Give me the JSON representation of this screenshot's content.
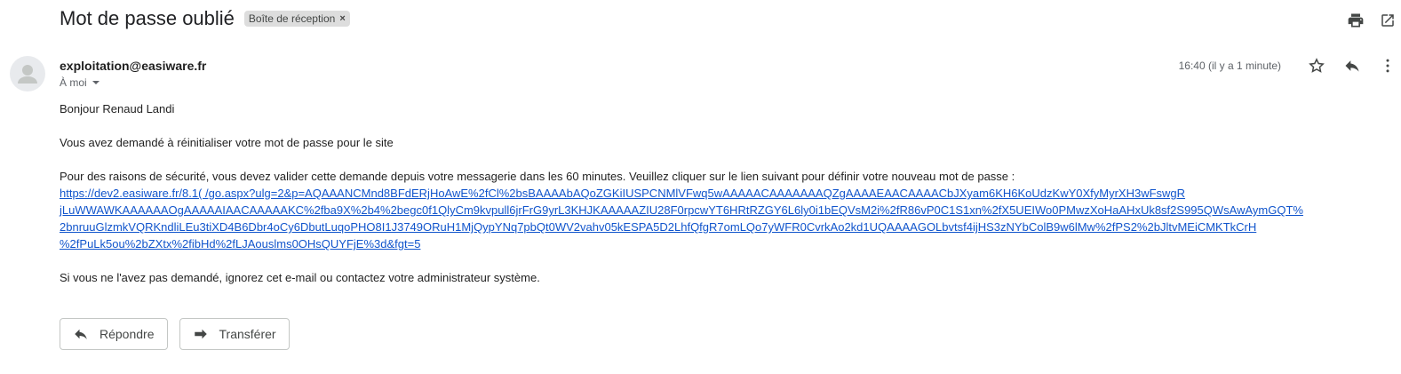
{
  "header": {
    "subject": "Mot de passe oublié",
    "label": "Boîte de réception",
    "label_remove": "×",
    "icons": [
      "print-icon",
      "open-in-new-window-icon"
    ]
  },
  "message": {
    "sender": "exploitation@easiware.fr",
    "recipient": "À moi",
    "time": "16:40 (il y a 1 minute)",
    "icons": [
      "star-icon",
      "reply-icon",
      "more-vertical-icon"
    ],
    "body": {
      "greeting": "Bonjour Renaud Landi",
      "line1": "Vous avez demandé à réinitialiser votre mot de passe pour le site",
      "line2": "Pour des raisons de sécurité, vous devez valider cette demande depuis votre messagerie dans les 60 minutes. Veuillez cliquer sur le lien suivant pour définir votre nouveau mot de passe :",
      "link_lines": [
        "https://dev2.easiware.fr/8.1(                              /go.aspx?ulg=2&p=AQAAANCMnd8BFdERjHoAwE%2fCl%2bsBAAAAbAQoZGKiIUSPCNMlVFwq5wAAAAACAAAAAAAQZgAAAAEAACAAAACbJXyam6KH6KoUdzKwY0XfyMyrXH3wFswgR",
        "jLuWWAWKAAAAAAOgAAAAAIAACAAAAAKC%2fba9X%2b4%2begc0f1QlyCm9kvpull6jrFrG9yrL3KHJKAAAAAZIU28F0rpcwYT6HRtRZGY6L6ly0i1bEQVsM2i%2fR86vP0C1S1xn%2fX5UEIWo0PMwzXoHaAHxUk8sf2S995QWsAwAymGQT%",
        "2bnruuGlzmkVQRKndliLEu3tiXD4B6Dbr4oCy6DbutLuqoPHO8I1J3749ORuH1MjQypYNq7pbQt0WV2vahv05kESPA5D2LhfQfgR7omLQo7yWFR0CvrkAo2kd1UQAAAAGOLbvtsf4ijHS3zNYbColB9w6lMw%2fPS2%2bJltvMEiCMKTkCrH",
        "%2fPuLk5ou%2bZXtx%2fibHd%2fLJAouslms0OHsQUYFjE%3d&fgt=5"
      ],
      "line3": "Si vous ne l'avez pas demandé, ignorez cet e-mail ou contactez votre administrateur système."
    }
  },
  "actions": {
    "reply": "Répondre",
    "forward": "Transférer"
  }
}
